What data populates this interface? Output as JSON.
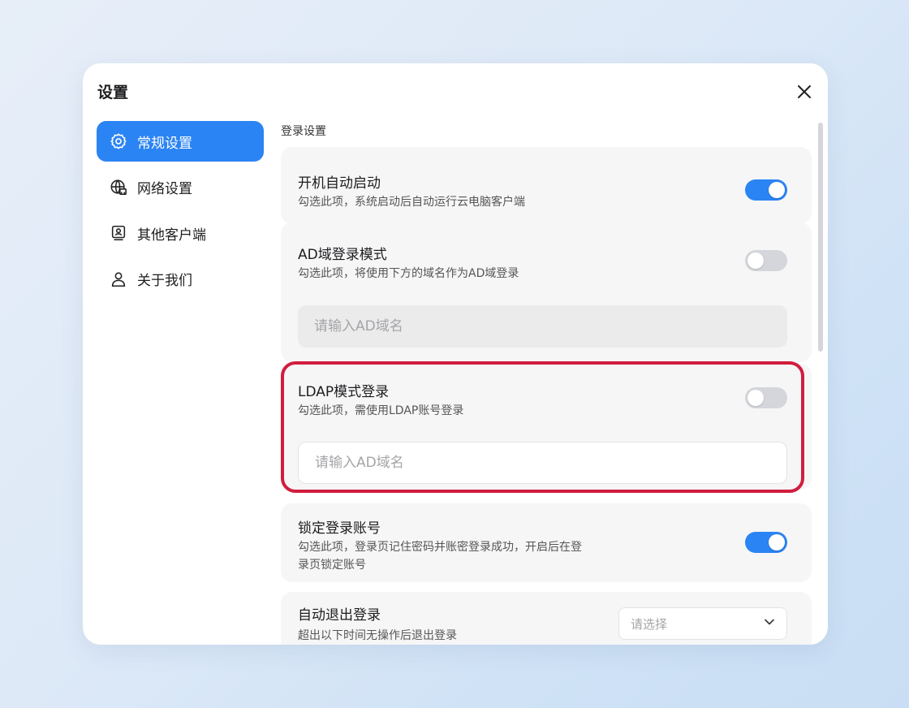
{
  "dialog": {
    "title": "设置"
  },
  "sidebar": {
    "items": [
      {
        "label": "常规设置",
        "icon": "gear-icon",
        "active": true
      },
      {
        "label": "网络设置",
        "icon": "network-globe-icon",
        "active": false
      },
      {
        "label": "其他客户端",
        "icon": "client-monitor-icon",
        "active": false
      },
      {
        "label": "关于我们",
        "icon": "user-icon",
        "active": false
      }
    ]
  },
  "main": {
    "section_title": "登录设置",
    "settings": {
      "auto_start": {
        "title": "开机自动启动",
        "desc": "勾选此项，系统启动后自动运行云电脑客户端",
        "enabled": true
      },
      "ad_login": {
        "title": "AD域登录模式",
        "desc": "勾选此项，将使用下方的域名作为AD域登录",
        "enabled": false,
        "input_placeholder": "请输入AD域名"
      },
      "ldap_login": {
        "title": "LDAP模式登录",
        "desc": "勾选此项，需使用LDAP账号登录",
        "enabled": false,
        "input_placeholder": "请输入AD域名"
      },
      "lock_account": {
        "title": "锁定登录账号",
        "desc_line1": "勾选此项，登录页记住密码并账密登录成功，开启后在登",
        "desc_line2": "录页锁定账号",
        "enabled": true
      },
      "auto_logout": {
        "title": "自动退出登录",
        "desc": "超出以下时间无操作后退出登录",
        "select_placeholder": "请选择"
      }
    }
  },
  "colors": {
    "accent": "#2b84f3",
    "highlight_border": "#d11d3e",
    "card_bg": "#f6f6f7"
  }
}
